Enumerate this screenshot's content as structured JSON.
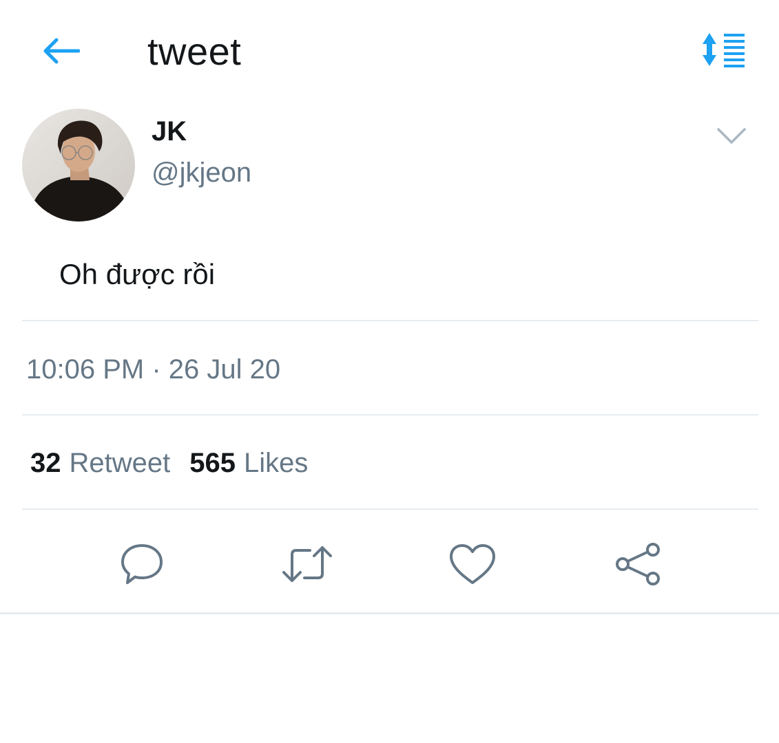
{
  "header": {
    "title": "tweet",
    "back_icon": "back-arrow-icon",
    "sort_icon": "sort-list-icon",
    "accent_color": "#1da1f2"
  },
  "author": {
    "display_name": "JK",
    "handle": "@jkjeon",
    "caret_icon": "chevron-down-icon"
  },
  "tweet": {
    "text": "Oh được rồi",
    "timestamp": "10:06 PM · 26 Jul 20"
  },
  "stats": {
    "retweets_count": "32",
    "retweets_label": "Retweet",
    "likes_count": "565",
    "likes_label": "Likes"
  },
  "actions": [
    {
      "icon": "reply-icon"
    },
    {
      "icon": "retweet-icon"
    },
    {
      "icon": "heart-icon"
    },
    {
      "icon": "share-icon"
    }
  ],
  "colors": {
    "text_primary": "#14171a",
    "text_secondary": "#657786",
    "icon_gray": "#657786",
    "divider": "#e6ecf0"
  }
}
